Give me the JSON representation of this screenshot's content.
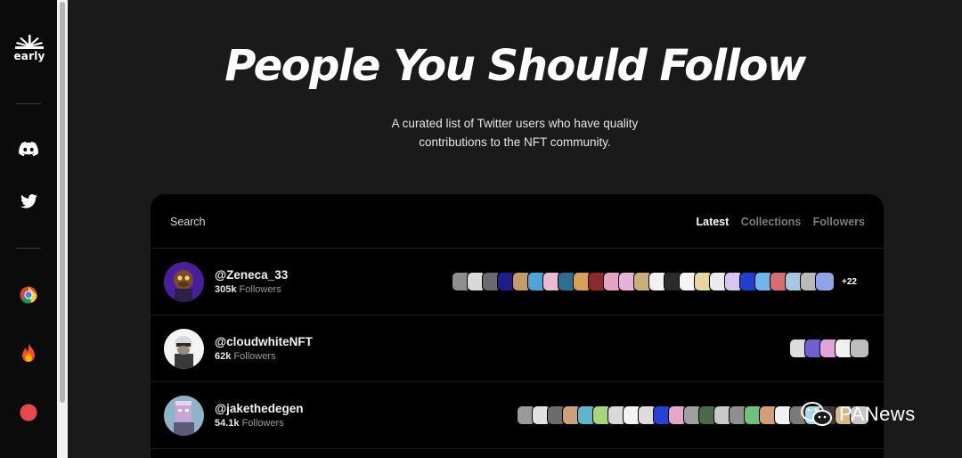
{
  "sidebar": {
    "logo_text": "early",
    "icons": [
      "discord-icon",
      "twitter-icon",
      "chrome-icon",
      "fire-icon",
      "record-dot-icon"
    ]
  },
  "header": {
    "title": "People You Should Follow",
    "subtitle_line1": "A curated list of Twitter users who have quality",
    "subtitle_line2": "contributions to the NFT community."
  },
  "card": {
    "search_label": "Search",
    "tabs": [
      {
        "label": "Latest",
        "active": true
      },
      {
        "label": "Collections",
        "active": false
      },
      {
        "label": "Followers",
        "active": false
      }
    ],
    "rows": [
      {
        "handle": "@Zeneca_33",
        "followers_count": "305k",
        "followers_label": "Followers",
        "more": "+22",
        "nft_colors": [
          "#8f8f8f",
          "#d9d9d9",
          "#6a6a6a",
          "#1d1d8c",
          "#c79a6a",
          "#4fa3d9",
          "#e9bcd0",
          "#2f6e8f",
          "#d9a05a",
          "#8b2a2a",
          "#e7a3c4",
          "#e6b3d6",
          "#c9b07a",
          "#f2f2f2",
          "#2b2b2b",
          "#f5f5f5",
          "#e8d4a0",
          "#ececec",
          "#d7c6f2",
          "#1f3fd1",
          "#6fb7e8",
          "#d86f6f",
          "#a9c6e0",
          "#b9b9b9",
          "#8fa3e6"
        ]
      },
      {
        "handle": "@cloudwhiteNFT",
        "followers_count": "62k",
        "followers_label": "Followers",
        "more": "",
        "nft_colors": [
          "#dcdcdc",
          "#6f5fd1",
          "#e2a3d9",
          "#f0f0f0",
          "#bdbdbd"
        ]
      },
      {
        "handle": "@jakethedegen",
        "followers_count": "54.1k",
        "followers_label": "Followers",
        "more": "",
        "nft_colors": [
          "#9a9a9a",
          "#e0e0e0",
          "#6c6c6c",
          "#c9a27a",
          "#5fb4cf",
          "#a6d67a",
          "#d9d9d9",
          "#f3f3f3",
          "#dcdcdc",
          "#2442d6",
          "#e6a6c9",
          "#9f9f9f",
          "#4a6b4a",
          "#c9c9c9",
          "#8f8f8f",
          "#6ec27a",
          "#d1a07a",
          "#f1f1f1",
          "#7a7a7a",
          "#a8d8e8",
          "#3a3a3a",
          "#d9b98a",
          "#c7c7c7"
        ]
      }
    ]
  },
  "watermark": {
    "text": "PANews"
  }
}
